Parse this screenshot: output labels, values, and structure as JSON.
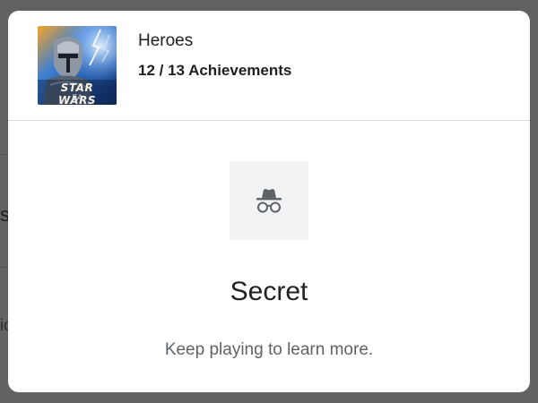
{
  "background": {
    "peek_texts": [
      "s",
      "ic"
    ]
  },
  "game": {
    "title": "Heroes",
    "achievements": "12 / 13 Achievements",
    "thumbnail_logo": "STAR WARS",
    "thumbnail_publisher": "EA"
  },
  "achievement": {
    "icon": "incognito-icon",
    "title": "Secret",
    "description": "Keep playing to learn more."
  },
  "colors": {
    "scrim": "#626262",
    "dialog": "#ffffff",
    "icon_tile": "#f1f3f4",
    "icon": "#5f6368",
    "primary_text": "#202124",
    "secondary_text": "#5f6368"
  }
}
